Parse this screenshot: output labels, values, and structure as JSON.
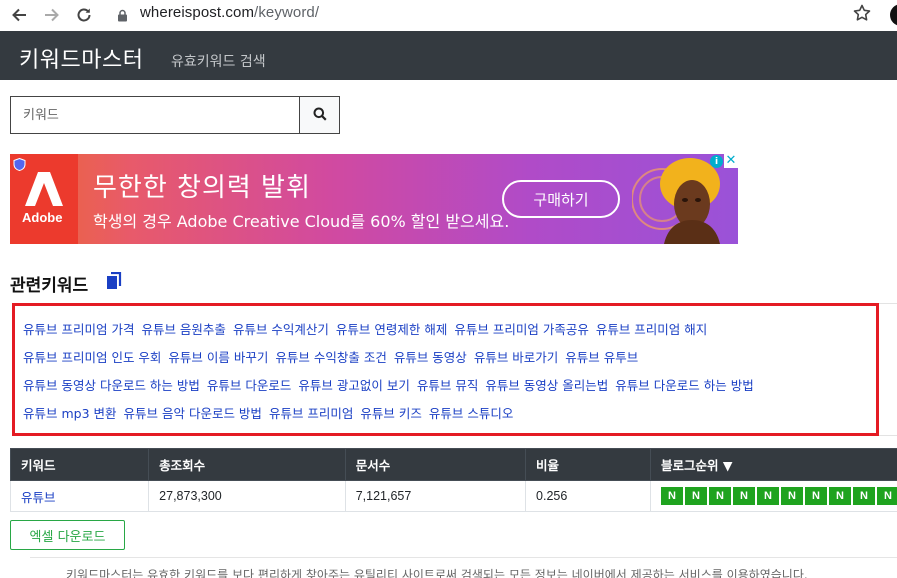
{
  "browser": {
    "url_host": "whereispost.com",
    "url_path": "/keyword/"
  },
  "header": {
    "brand": "키워드마스터",
    "subtitle": "유효키워드 검색"
  },
  "search": {
    "placeholder": "키워드"
  },
  "ad": {
    "logo_text": "Adobe",
    "headline": "무한한 창의력 발휘",
    "sub": "학생의 경우 Adobe Creative Cloud를 60% 할인 받으세요.",
    "cta": "구매하기"
  },
  "related": {
    "title": "관련키워드",
    "lines": [
      [
        "유튜브 프리미엄 가격",
        "유튜브 음원추출",
        "유튜브 수익계산기",
        "유튜브 연령제한 해제",
        "유튜브 프리미엄 가족공유",
        "유튜브 프리미엄 해지"
      ],
      [
        "유튜브 프리미엄 인도 우회",
        "유튜브 이름 바꾸기",
        "유튜브 수익창출 조건",
        "유튜브 동영상",
        "유튜브 바로가기",
        "유튜브 유투브"
      ],
      [
        "유튜브 동영상 다운로드 하는 방법",
        "유튜브 다운로드",
        "유튜브 광고없이 보기",
        "유튜브 뮤직",
        "유튜브 동영상 올리는법",
        "유튜브 다운로드 하는 방법"
      ],
      [
        "유튜브 mp3 변환",
        "유튜브 음악 다운로드 방법",
        "유튜브 프리미엄",
        "유튜브 키즈",
        "유튜브 스튜디오"
      ]
    ]
  },
  "table": {
    "headers": [
      "키워드",
      "총조회수",
      "문서수",
      "비율",
      "블로그순위 ▼"
    ],
    "rows": [
      {
        "keyword": "유튜브",
        "views": "27,873,300",
        "docs": "7,121,657",
        "ratio": "0.256",
        "ranks": [
          "N",
          "N",
          "N",
          "N",
          "N",
          "N",
          "N",
          "N",
          "N",
          "N"
        ]
      }
    ]
  },
  "excel_button": "엑셀 다운로드",
  "footer_text": "키워드마스터는 유효한 키워드를 보다 편리하게 찾아주는 유틸리티 사이트로써 검색되는 모든 정보는 네이버에서 제공하는 서비스를 이용하였습니다.",
  "colors": {
    "topbar": "#343a40",
    "keyword_box_border": "#e41b23",
    "keyword_link": "#1a3fc4",
    "rank_badge": "#1fa31f",
    "excel_green": "#28a745"
  }
}
